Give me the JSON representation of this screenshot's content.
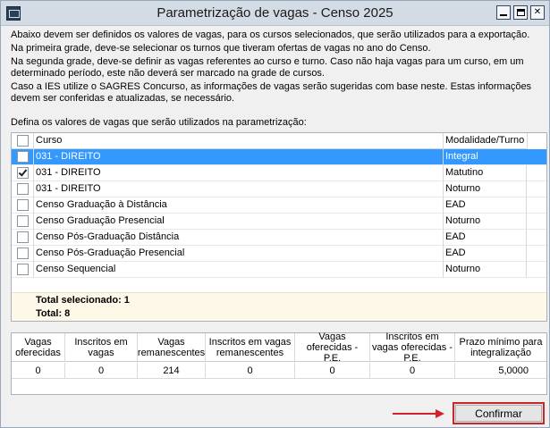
{
  "window": {
    "title": "Parametrização de vagas - Censo 2025",
    "controls": {
      "minimize": "minimize",
      "maximize": "maximize",
      "close": "✕"
    }
  },
  "intro": [
    "Abaixo devem ser definidos os valores de vagas, para os cursos selecionados, que serão utilizados para a exportação.",
    "Na primeira grade, deve-se selecionar os turnos que tiveram ofertas de vagas no ano do Censo.",
    "Na segunda grade, deve-se definir as vagas referentes ao curso e turno. Caso não haja vagas para um curso, em um determinado período, este não deverá ser marcado na grade de cursos.",
    "Caso a IES utilize o SAGRES Concurso, as informações de vagas serão sugeridas com base neste. Estas informações devem ser conferidas e atualizadas, se necessário."
  ],
  "grid_caption": "Defina os valores de vagas que serão utilizados na parametrização:",
  "course_grid": {
    "headers": {
      "course": "Curso",
      "mode": "Modalidade/Turno"
    },
    "rows": [
      {
        "course": "031 - DIREITO",
        "mode": "Integral",
        "checked": false,
        "selected": true
      },
      {
        "course": "031 - DIREITO",
        "mode": "Matutino",
        "checked": true,
        "selected": false
      },
      {
        "course": "031 - DIREITO",
        "mode": "Noturno",
        "checked": false,
        "selected": false
      },
      {
        "course": "Censo Graduação à Distância",
        "mode": "EAD",
        "checked": false,
        "selected": false
      },
      {
        "course": "Censo Graduação Presencial",
        "mode": "Noturno",
        "checked": false,
        "selected": false
      },
      {
        "course": "Censo Pós-Graduação Distância",
        "mode": "EAD",
        "checked": false,
        "selected": false
      },
      {
        "course": "Censo Pós-Graduação Presencial",
        "mode": "EAD",
        "checked": false,
        "selected": false
      },
      {
        "course": "Censo Sequencial",
        "mode": "Noturno",
        "checked": false,
        "selected": false
      }
    ],
    "total_selected": "Total selecionado: 1",
    "total": "Total: 8"
  },
  "vacancy_grid": {
    "headers": [
      "Vagas oferecidas",
      "Inscritos em vagas",
      "Vagas remanescentes",
      "Inscritos em vagas remanescentes",
      "Vagas oferecidas - P.E.",
      "Inscritos em vagas oferecidas - P.E.",
      "Prazo mínimo para integralização"
    ],
    "values": [
      "0",
      "0",
      "214",
      "0",
      "0",
      "0",
      "5,0000"
    ]
  },
  "confirm_label": "Confirmar",
  "colors": {
    "selection": "#3399ff",
    "highlight": "#d4212a",
    "footer_bg": "#fdf8e8"
  }
}
